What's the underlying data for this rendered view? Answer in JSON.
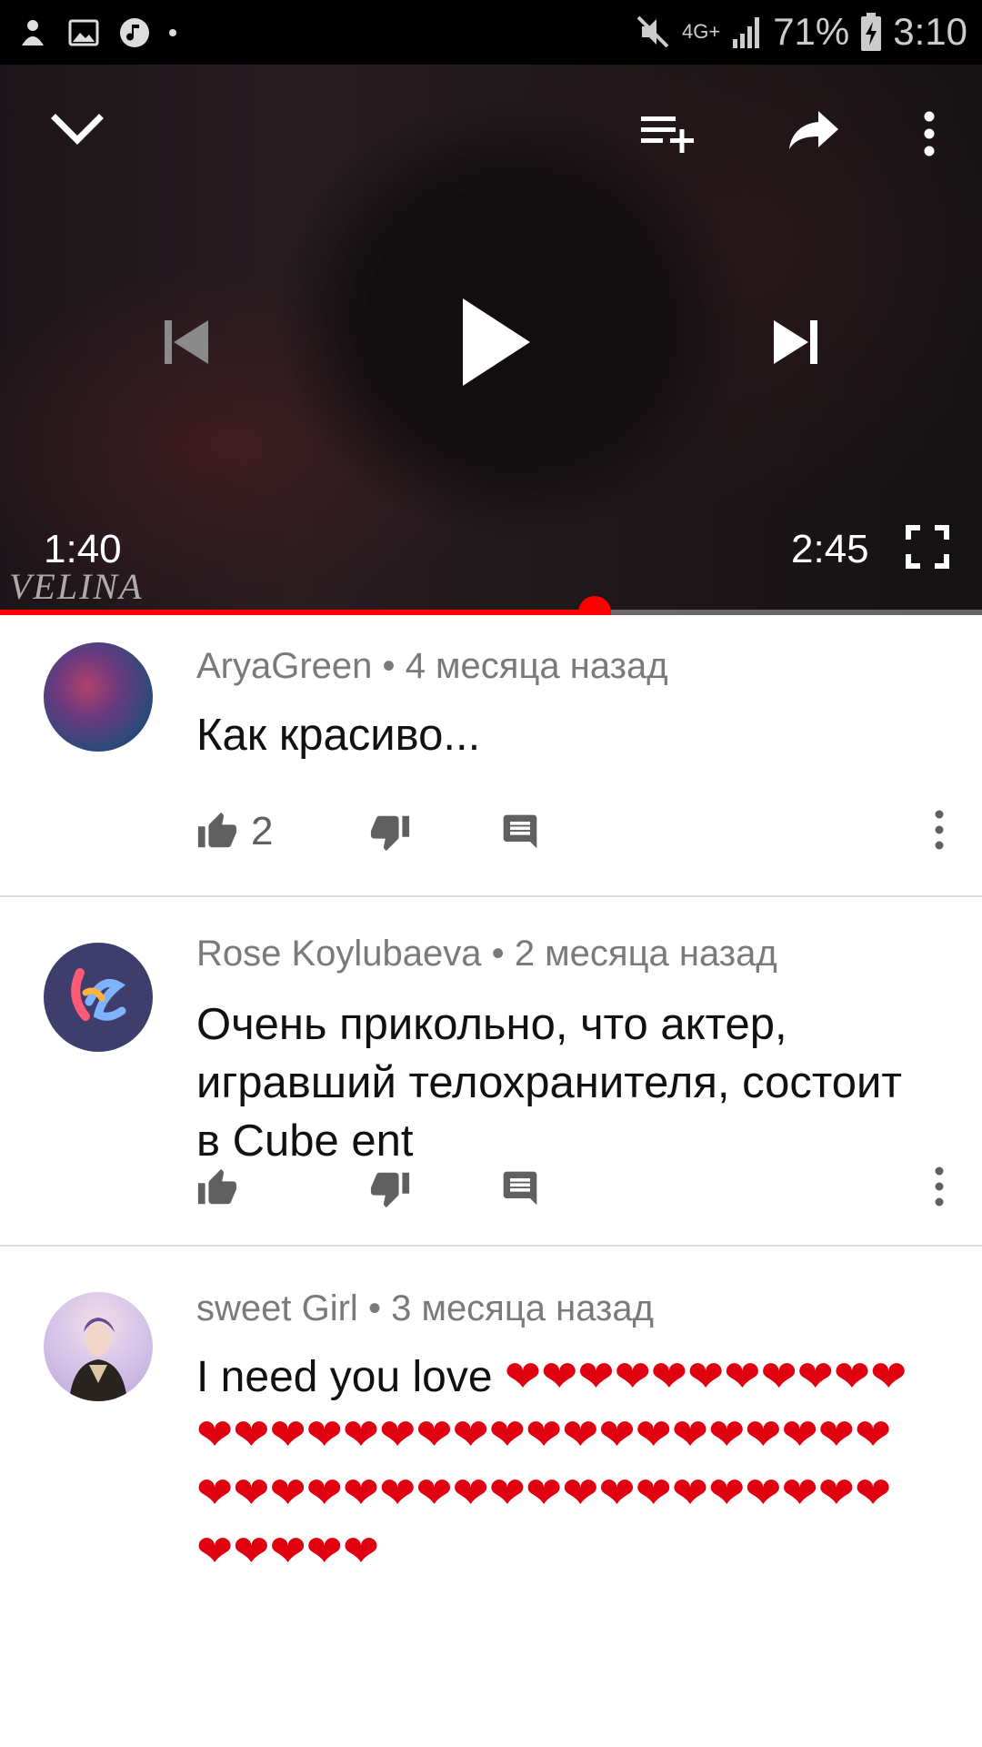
{
  "status_bar": {
    "network": "4G+",
    "battery": "71%",
    "time": "3:10",
    "left_icons": [
      "notification-app-icon",
      "image-icon",
      "music-icon"
    ],
    "right_icons": [
      "mute-icon",
      "signal-icon",
      "battery-icon"
    ]
  },
  "player": {
    "current_time": "1:40",
    "duration": "2:45",
    "watermark": "VELINA",
    "progress_fraction": 0.606,
    "accent_color": "#ff0000",
    "icons": [
      "chevron-down-icon",
      "add-to-queue-icon",
      "share-icon",
      "more-vert-icon",
      "previous-icon",
      "play-icon",
      "next-icon",
      "fullscreen-icon"
    ]
  },
  "comments": [
    {
      "author": "AryaGreen",
      "separator": "•",
      "age": "4 месяца назад",
      "text": "Как красиво...",
      "likes": "2"
    },
    {
      "author": "Rose Koylubaeva",
      "separator": "•",
      "age": "2 месяца назад",
      "text": "Очень прикольно, что актер, игравший телохранителя, состоит в Cube ent",
      "likes": ""
    },
    {
      "author": "sweet Girl",
      "separator": "•",
      "age": "3 месяца назад",
      "text": "I need you love ",
      "hearts": "❤❤❤❤❤❤❤❤❤❤❤❤❤❤❤❤❤❤❤❤❤❤❤❤❤❤❤❤❤❤❤❤❤❤❤❤❤❤❤❤❤❤❤❤❤❤❤❤❤❤❤❤❤❤",
      "likes": ""
    }
  ]
}
